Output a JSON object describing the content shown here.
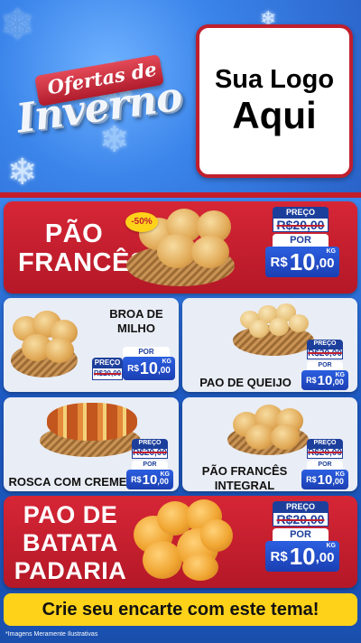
{
  "header": {
    "title_line1": "Ofertas de",
    "title_line2": "Inverno",
    "logo_line1": "Sua Logo",
    "logo_line2": "Aqui"
  },
  "labels": {
    "preco": "PREÇO",
    "por": "POR",
    "currency": "R$",
    "unit": "KG"
  },
  "featured": [
    {
      "name_line1": "PÃO",
      "name_line2": "FRANCÊS",
      "discount": "-50%",
      "old_price": "R$20,00",
      "new_price_int": "10",
      "new_price_cents": ",00"
    },
    {
      "name_line1": "PAO DE",
      "name_line2": "BATATA",
      "name_line3": "PADARIA",
      "old_price": "R$20,00",
      "new_price_int": "10",
      "new_price_cents": ",00"
    }
  ],
  "products": [
    {
      "name_line1": "BROA DE",
      "name_line2": "MILHO",
      "old_price": "R$20,00",
      "new_price_int": "10",
      "new_price_cents": ",00"
    },
    {
      "name_line1": "PAO DE QUEIJO",
      "old_price": "R$20,00",
      "new_price_int": "10",
      "new_price_cents": ",00"
    },
    {
      "name_line1": "ROSCA COM CREME",
      "old_price": "R$20,00",
      "new_price_int": "10",
      "new_price_cents": ",00"
    },
    {
      "name_line1": "PÃO FRANCÊS",
      "name_line2": "INTEGRAL",
      "old_price": "R$20,00",
      "new_price_int": "10",
      "new_price_cents": ",00"
    }
  ],
  "cta": "Crie seu encarte com este tema!",
  "disclaimer": "*Imagens Meramente Ilustrativas",
  "colors": {
    "brand_red": "#c51d2b",
    "brand_blue": "#1d3f9c",
    "cta_yellow": "#ffd21a",
    "background_blue": "#2f6fd6"
  },
  "icons": [
    "snowflake-icon"
  ]
}
